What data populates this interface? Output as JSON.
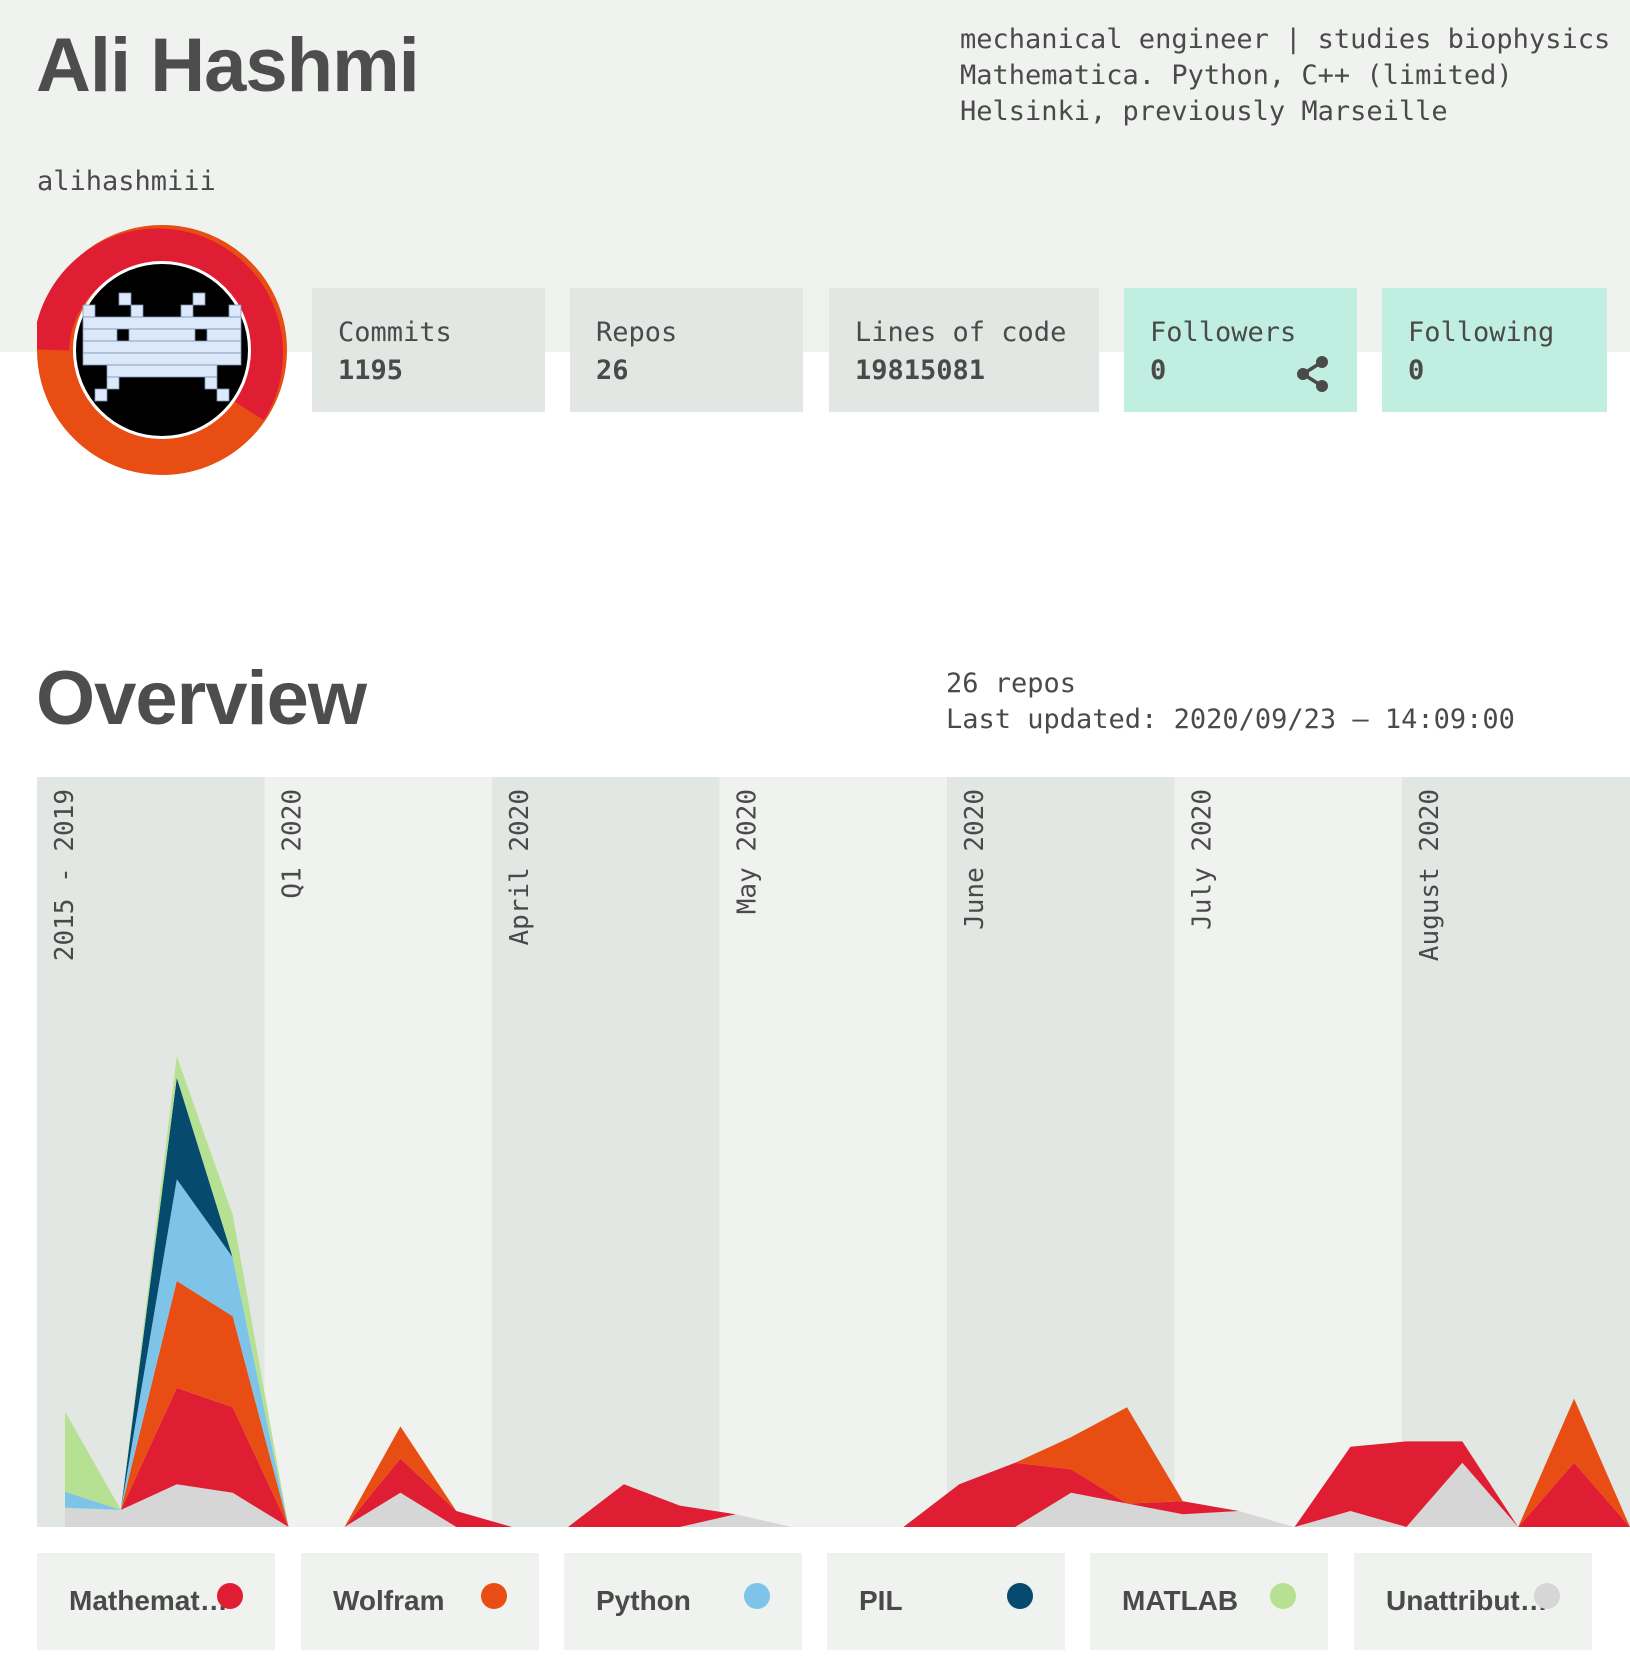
{
  "profile": {
    "name": "Ali Hashmi",
    "bio": [
      "mechanical engineer | studies biophysics",
      "Mathematica. Python, C++ (limited)",
      "Helsinki, previously Marseille"
    ],
    "username": "alihashmiii"
  },
  "stats": [
    {
      "label": "Commits",
      "value": "1195"
    },
    {
      "label": "Repos",
      "value": "26"
    },
    {
      "label": "Lines of code",
      "value": "19815081"
    },
    {
      "label": "Followers",
      "value": "0"
    },
    {
      "label": "Following",
      "value": "0"
    }
  ],
  "icons": {
    "share": "share-icon",
    "avatar": "space-invader-avatar"
  },
  "overview": {
    "title": "Overview",
    "repos": "26 repos",
    "updated": "Last updated: 2020/09/23 – 14:09:00"
  },
  "colors": {
    "Mathematica": "#e01e33",
    "Wolfram": "#e84e13",
    "Python": "#7ec4e8",
    "PIL": "#064a6e",
    "MATLAB": "#b6e192",
    "Unattributed": "#d6d6d6"
  },
  "chart_data": {
    "type": "area",
    "stacked": true,
    "periods": [
      "2015 - 2019",
      "Q1 2020",
      "April 2020",
      "May 2020",
      "June 2020",
      "July 2020",
      "August 2020"
    ],
    "x": [
      0,
      1,
      2,
      3,
      4,
      5,
      6,
      7,
      8,
      9,
      10,
      11,
      12,
      13,
      14,
      15,
      16,
      17,
      18,
      19,
      20,
      21,
      22,
      23,
      24,
      25,
      26,
      27,
      28
    ],
    "series": [
      {
        "name": "Unattributed",
        "values": [
          18,
          16,
          40,
          32,
          0,
          0,
          32,
          0,
          0,
          0,
          0,
          0,
          12,
          0,
          0,
          0,
          0,
          0,
          32,
          22,
          12,
          15,
          0,
          15,
          0,
          60,
          0,
          0,
          0
        ]
      },
      {
        "name": "Mathematica",
        "values": [
          0,
          0,
          90,
          80,
          0,
          0,
          32,
          15,
          0,
          0,
          40,
          20,
          0,
          0,
          0,
          0,
          40,
          60,
          22,
          0,
          12,
          0,
          0,
          60,
          80,
          20,
          0,
          60,
          0
        ]
      },
      {
        "name": "Wolfram",
        "values": [
          0,
          0,
          100,
          85,
          0,
          0,
          30,
          0,
          0,
          0,
          0,
          0,
          0,
          0,
          0,
          0,
          0,
          0,
          30,
          90,
          0,
          0,
          0,
          0,
          0,
          0,
          0,
          60,
          0
        ]
      },
      {
        "name": "Python",
        "values": [
          15,
          0,
          95,
          55,
          0,
          0,
          0,
          0,
          0,
          0,
          0,
          0,
          0,
          0,
          0,
          0,
          0,
          0,
          0,
          0,
          0,
          0,
          0,
          0,
          0,
          0,
          0,
          0,
          0
        ]
      },
      {
        "name": "PIL",
        "values": [
          0,
          0,
          95,
          0,
          0,
          0,
          0,
          0,
          0,
          0,
          0,
          0,
          0,
          0,
          0,
          0,
          0,
          0,
          0,
          0,
          0,
          0,
          0,
          0,
          0,
          0,
          0,
          0,
          0
        ]
      },
      {
        "name": "MATLAB",
        "values": [
          75,
          0,
          20,
          40,
          0,
          0,
          0,
          0,
          0,
          0,
          0,
          0,
          0,
          0,
          0,
          0,
          0,
          0,
          0,
          0,
          0,
          0,
          0,
          0,
          0,
          0,
          0,
          0,
          0
        ]
      }
    ],
    "ylim": [
      0,
      430
    ],
    "legend": [
      "Mathemat…",
      "Wolfram",
      "Python",
      "PIL",
      "MATLAB",
      "Unattribut…"
    ],
    "legend_position": "bottom"
  }
}
